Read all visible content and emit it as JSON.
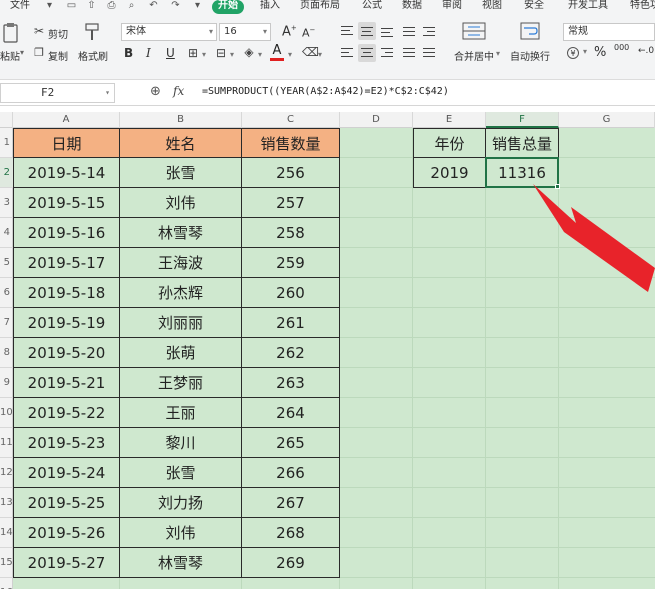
{
  "menu": {
    "file": "文件",
    "tabs": [
      "开始",
      "插入",
      "页面布局",
      "公式",
      "数据",
      "审阅",
      "视图",
      "安全",
      "开发工具",
      "特色功"
    ]
  },
  "ribbon": {
    "paste": "粘贴",
    "cut": "剪切",
    "copy": "复制",
    "format_painter": "格式刷",
    "font_name": "宋体",
    "font_size": "16",
    "merge_center": "合并居中",
    "wrap_text": "自动换行",
    "number_format": "常规",
    "bold": "B",
    "italic": "I",
    "underline": "U",
    "font_grow": "A",
    "font_shrink": "A",
    "currency": "¥",
    "percent": "%",
    "thousands": "000"
  },
  "formula_bar": {
    "name_box": "F2",
    "fx": "fx",
    "formula": "=SUMPRODUCT((YEAR(A$2:A$42)=E2)*C$2:C$42)"
  },
  "columns": [
    "A",
    "B",
    "C",
    "D",
    "E",
    "F",
    "G"
  ],
  "row_numbers": [
    "1",
    "2",
    "3",
    "4",
    "5",
    "6",
    "7",
    "8",
    "9",
    "10",
    "11",
    "12",
    "13",
    "14",
    "15",
    "16"
  ],
  "table": {
    "headers": [
      "日期",
      "姓名",
      "销售数量"
    ],
    "rows": [
      [
        "2019-5-14",
        "张雪",
        "256"
      ],
      [
        "2019-5-15",
        "刘伟",
        "257"
      ],
      [
        "2019-5-16",
        "林雪琴",
        "258"
      ],
      [
        "2019-5-17",
        "王海波",
        "259"
      ],
      [
        "2019-5-18",
        "孙杰辉",
        "260"
      ],
      [
        "2019-5-19",
        "刘丽丽",
        "261"
      ],
      [
        "2019-5-20",
        "张萌",
        "262"
      ],
      [
        "2019-5-21",
        "王梦丽",
        "263"
      ],
      [
        "2019-5-22",
        "王丽",
        "264"
      ],
      [
        "2019-5-23",
        "黎川",
        "265"
      ],
      [
        "2019-5-24",
        "张雪",
        "266"
      ],
      [
        "2019-5-25",
        "刘力扬",
        "267"
      ],
      [
        "2019-5-26",
        "刘伟",
        "268"
      ],
      [
        "2019-5-27",
        "林雪琴",
        "269"
      ]
    ]
  },
  "summary": {
    "year_header": "年份",
    "total_header": "销售总量",
    "year": "2019",
    "total": "11316"
  },
  "colors": {
    "header_fill": "#f4b183",
    "sheet_bg": "#cfe8cf",
    "selection": "#217346",
    "arrow": "#e8232a"
  }
}
